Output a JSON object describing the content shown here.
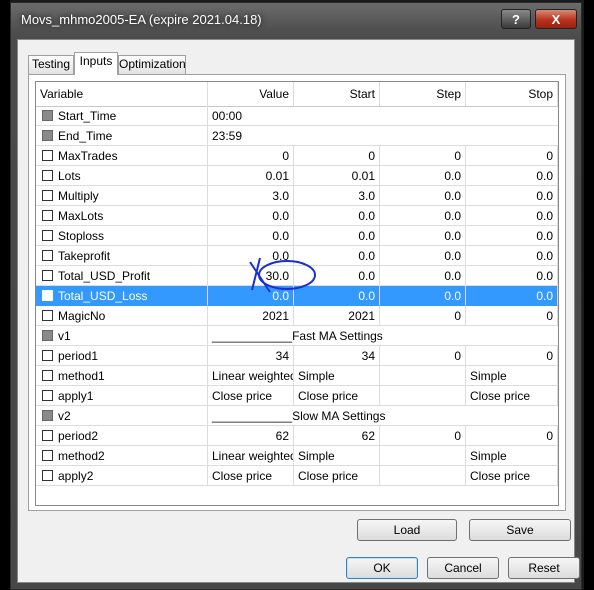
{
  "window": {
    "title": "Movs_mhmo2005-EA (expire 2021.04.18)",
    "help_label": "?",
    "close_label": "X"
  },
  "tabs": [
    {
      "label": "Testing"
    },
    {
      "label": "Inputs"
    },
    {
      "label": "Optimization"
    }
  ],
  "active_tab": "Inputs",
  "table": {
    "columns": [
      "Variable",
      "Value",
      "Start",
      "Step",
      "Stop"
    ],
    "rows": [
      {
        "name": "Start_Time",
        "value": "00:00",
        "disabled": true
      },
      {
        "name": "End_Time",
        "value": "23:59",
        "disabled": true
      },
      {
        "name": "MaxTrades",
        "value": "0",
        "start": "0",
        "step": "0",
        "stop": "0"
      },
      {
        "name": "Lots",
        "value": "0.01",
        "start": "0.01",
        "step": "0.0",
        "stop": "0.0"
      },
      {
        "name": "Multiply",
        "value": "3.0",
        "start": "3.0",
        "step": "0.0",
        "stop": "0.0"
      },
      {
        "name": "MaxLots",
        "value": "0.0",
        "start": "0.0",
        "step": "0.0",
        "stop": "0.0"
      },
      {
        "name": "Stoploss",
        "value": "0.0",
        "start": "0.0",
        "step": "0.0",
        "stop": "0.0"
      },
      {
        "name": "Takeprofit",
        "value": "0.0",
        "start": "0.0",
        "step": "0.0",
        "stop": "0.0"
      },
      {
        "name": "Total_USD_Profit",
        "value": "30.0",
        "start": "0.0",
        "step": "0.0",
        "stop": "0.0"
      },
      {
        "name": "Total_USD_Loss",
        "value": "0.0",
        "start": "0.0",
        "step": "0.0",
        "stop": "0.0",
        "selected": true
      },
      {
        "name": "MagicNo",
        "value": "2021",
        "start": "2021",
        "step": "0",
        "stop": "0"
      },
      {
        "name": "v1",
        "value": "____________Fast MA Settings",
        "disabled": true,
        "merged": true
      },
      {
        "name": "period1",
        "value": "34",
        "start": "34",
        "step": "0",
        "stop": "0"
      },
      {
        "name": "method1",
        "value": "Linear weighted",
        "start": "Simple",
        "step": "",
        "stop": "Simple",
        "text": true
      },
      {
        "name": "apply1",
        "value": "Close price",
        "start": "Close price",
        "step": "",
        "stop": "Close price",
        "text": true
      },
      {
        "name": "v2",
        "value": "____________Slow MA Settings",
        "disabled": true,
        "merged": true
      },
      {
        "name": "period2",
        "value": "62",
        "start": "62",
        "step": "0",
        "stop": "0"
      },
      {
        "name": "method2",
        "value": "Linear weighted",
        "start": "Simple",
        "step": "",
        "stop": "Simple",
        "text": true
      },
      {
        "name": "apply2",
        "value": "Close price",
        "start": "Close price",
        "step": "",
        "stop": "Close price",
        "text": true
      }
    ]
  },
  "buttons": {
    "load": "Load",
    "save": "Save",
    "ok": "OK",
    "cancel": "Cancel",
    "reset": "Reset"
  },
  "colors": {
    "selection": "#3399ff",
    "annotation": "#1a2fd0",
    "close_button": "#c0392b"
  }
}
